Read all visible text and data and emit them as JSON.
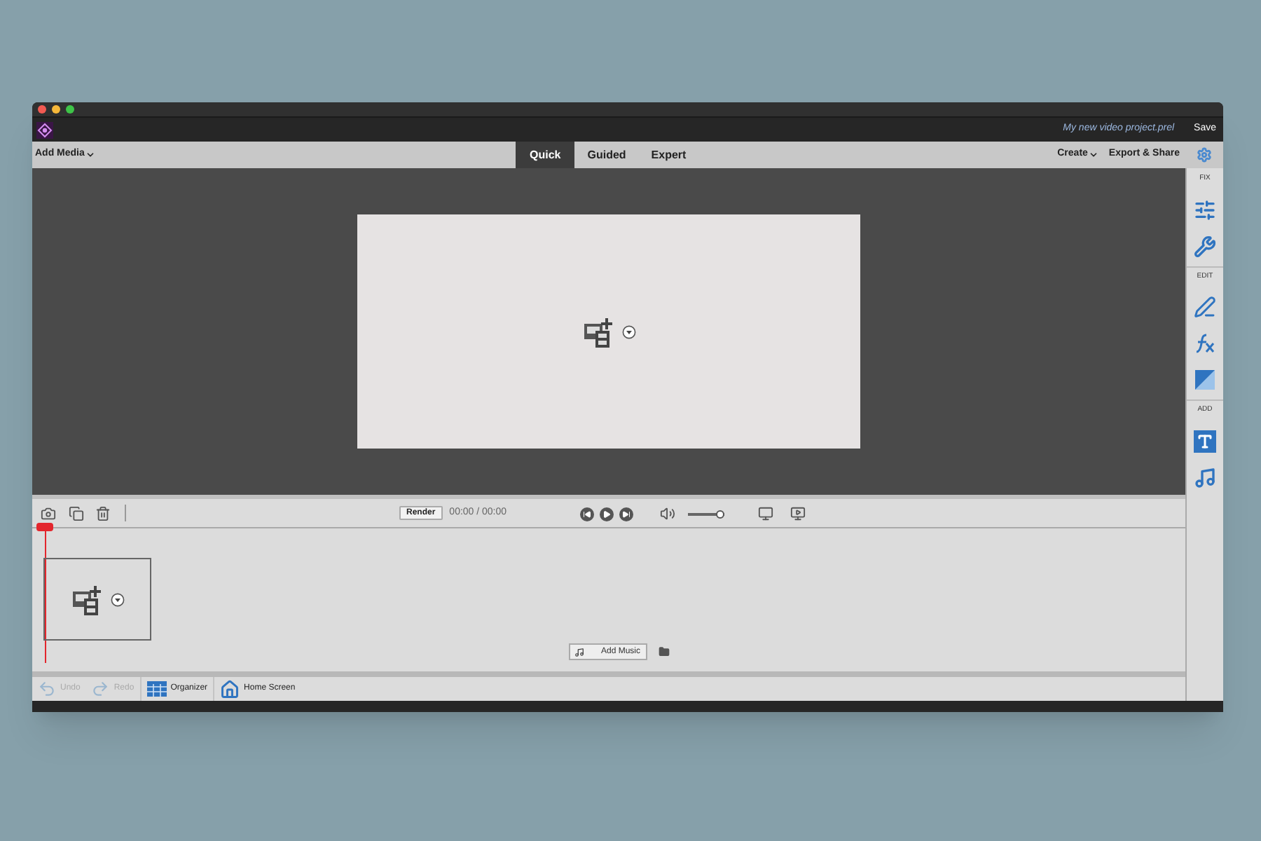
{
  "window": {
    "title": "My new video project.prel",
    "save": "Save"
  },
  "toolbar": {
    "add_media": "Add Media",
    "tabs": [
      {
        "label": "Quick",
        "selected": true
      },
      {
        "label": "Guided",
        "selected": false
      },
      {
        "label": "Expert",
        "selected": false
      }
    ],
    "create": "Create",
    "export_share": "Export & Share"
  },
  "side_panel": {
    "sections": [
      {
        "label": "FIX",
        "tools": [
          {
            "kind": "sliders"
          },
          {
            "kind": "tools"
          }
        ]
      },
      {
        "label": "EDIT",
        "tools": [
          {
            "kind": "fx-pen"
          },
          {
            "kind": "fx"
          },
          {
            "kind": "gradient"
          }
        ]
      },
      {
        "label": "ADD",
        "tools": [
          {
            "kind": "text"
          },
          {
            "kind": "music"
          }
        ]
      }
    ]
  },
  "player": {
    "render": "Render",
    "time": "00:00 / 00:00",
    "volume": {
      "level": 1
    }
  },
  "timeline": {
    "add_music": "Add Music"
  },
  "bottom_bar": {
    "buttons": [
      {
        "kind": "undo",
        "label": "Undo",
        "disabled": true
      },
      {
        "kind": "redo",
        "label": "Redo",
        "disabled": true
      },
      {
        "kind": "organizer",
        "label": "Organizer",
        "disabled": false
      },
      {
        "kind": "home",
        "label": "Home Screen",
        "disabled": false
      }
    ]
  }
}
